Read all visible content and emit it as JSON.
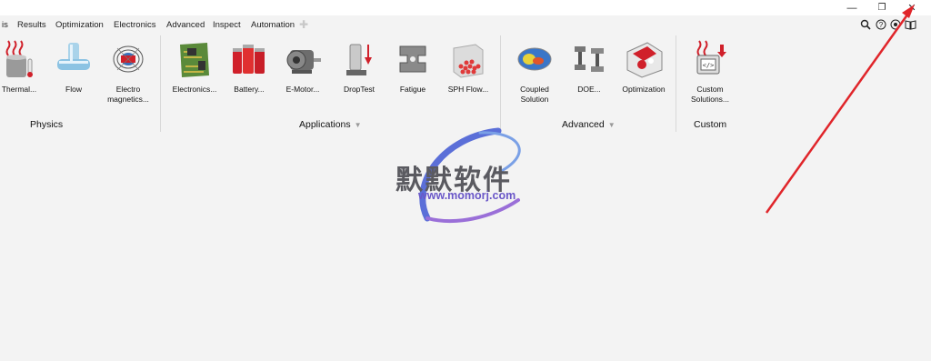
{
  "menu": {
    "items": [
      "is",
      "Results",
      "Optimization",
      "Electronics",
      "Advanced",
      "Inspect",
      "Automation"
    ]
  },
  "window_controls": {
    "minimize": "—",
    "restore": "❐",
    "close": "✕"
  },
  "help": {
    "search": "⚲",
    "help": "?",
    "settings": "⚙",
    "book": "📖"
  },
  "groups": {
    "physics": "Physics",
    "applications": "Applications",
    "advanced": "Advanced",
    "custom": "Custom",
    "chevron": "▼"
  },
  "tools": {
    "thermal": "Thermal...",
    "flow": "Flow",
    "electromagnetics": "Electro\nmagnetics...",
    "electronics": "Electronics...",
    "battery": "Battery...",
    "emotor": "E-Motor...",
    "droptest": "DropTest",
    "fatigue": "Fatigue",
    "sphflow": "SPH Flow...",
    "coupled": "Coupled\nSolution",
    "doe": "DOE...",
    "optimization": "Optimization",
    "custom_solutions": "Custom\nSolutions..."
  },
  "watermark": {
    "cn_text": "默默软件",
    "url": "www.momorj.com"
  },
  "colors": {
    "arrow": "#e0252a",
    "watermark_purple": "#6a57c8",
    "watermark_blue": "#3a6fd8"
  }
}
